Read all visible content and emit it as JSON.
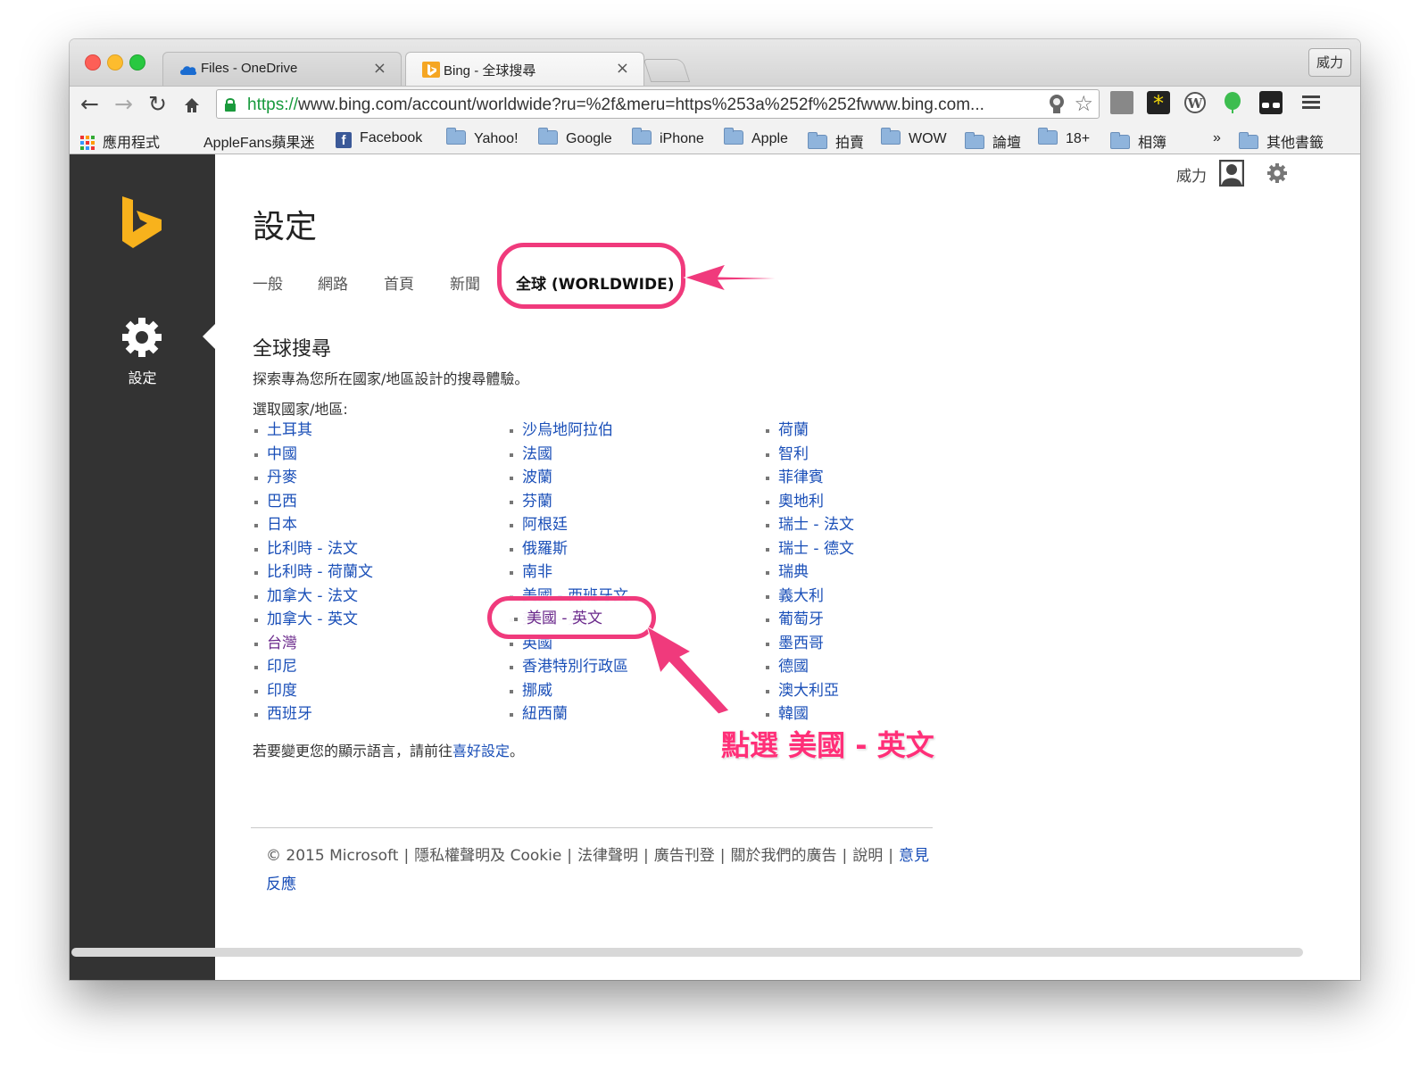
{
  "tabs": [
    {
      "title": "Files - OneDrive",
      "close": "×"
    },
    {
      "title": "Bing - 全球搜尋",
      "close": "×"
    }
  ],
  "profile_label": "威力",
  "toolbar": {
    "url_scheme": "https://",
    "url_rest": "www.bing.com/account/worldwide?ru=%2f&meru=https%253a%252f%252fwww.bing.com..."
  },
  "bookmarks": {
    "apps": "應用程式",
    "items": [
      "AppleFans蘋果迷",
      "Facebook",
      "Yahoo!",
      "Google",
      "iPhone",
      "Apple",
      "拍賣",
      "WOW",
      "論壇",
      "18+",
      "相簿"
    ],
    "more": "»",
    "other": "其他書籤"
  },
  "sidebar": {
    "settings_label": "設定"
  },
  "userbar": {
    "name": "威力"
  },
  "page": {
    "title": "設定",
    "nav_tabs": [
      "一般",
      "網路",
      "首頁",
      "新聞",
      "全球 (WORLDWIDE)"
    ],
    "section_title": "全球搜尋",
    "section_desc": "探索專為您所在國家/地區設計的搜尋體驗。",
    "select_label": "選取國家/地區:",
    "col1": [
      "土耳其",
      "中國",
      "丹麥",
      "巴西",
      "日本",
      "比利時 - 法文",
      "比利時 - 荷蘭文",
      "加拿大 - 法文",
      "加拿大 - 英文",
      "台灣",
      "印尼",
      "印度",
      "西班牙"
    ],
    "col2": [
      "沙烏地阿拉伯",
      "法國",
      "波蘭",
      "芬蘭",
      "阿根廷",
      "俄羅斯",
      "南非",
      "美國 - 西班牙文",
      "美國 - 英文",
      "英國",
      "香港特別行政區",
      "挪威",
      "紐西蘭"
    ],
    "col3": [
      "荷蘭",
      "智利",
      "菲律賓",
      "奧地利",
      "瑞士 - 法文",
      "瑞士 - 德文",
      "瑞典",
      "義大利",
      "葡萄牙",
      "墨西哥",
      "德國",
      "澳大利亞",
      "韓國"
    ],
    "lang_note_pre": "若要變更您的顯示語言，請前往",
    "lang_note_link": "喜好設定",
    "lang_note_post": "。"
  },
  "footer": {
    "copyright": "© 2015 Microsoft",
    "links": [
      "隱私權聲明及 Cookie",
      "法律聲明",
      "廣告刊登",
      "關於我們的廣告",
      "說明",
      "意見反應"
    ]
  },
  "annotation": {
    "text": "點選 美國 - 英文",
    "color": "#ff2f78"
  }
}
